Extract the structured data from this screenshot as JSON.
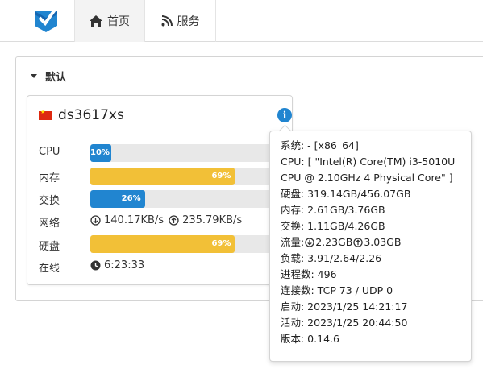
{
  "nav": {
    "home_label": "首页",
    "services_label": "服务"
  },
  "group": {
    "title": "默认"
  },
  "server": {
    "name": "ds3617xs",
    "cpu": {
      "label": "CPU",
      "percent": 10,
      "text": "10%"
    },
    "mem": {
      "label": "内存",
      "percent": 69,
      "text": "69%"
    },
    "swap": {
      "label": "交换",
      "percent": 26,
      "text": "26%"
    },
    "net": {
      "label": "网络",
      "down": "140.17KB/s",
      "up": "235.79KB/s"
    },
    "disk": {
      "label": "硬盘",
      "percent": 69,
      "text": "69%"
    },
    "uptime": {
      "label": "在线",
      "value": "6:23:33"
    }
  },
  "popup": {
    "system": "系统: - [x86_64]",
    "cpu1": "CPU: [ \"Intel(R) Core(TM) i3-5010U",
    "cpu2": "CPU @ 2.10GHz 4 Physical Core\" ]",
    "disk": "硬盘: 319.14GB/456.07GB",
    "mem": "内存: 2.61GB/3.76GB",
    "swap": "交换: 1.11GB/4.26GB",
    "traffic_label": "流量: ",
    "traffic_down": "2.23GB",
    "traffic_up": "3.03GB",
    "load": "负载: 3.91/2.64/2.26",
    "procs": "进程数: 496",
    "conns": "连接数: TCP 73 / UDP 0",
    "boot": "启动: 2023/1/25 14:21:17",
    "active": "活动: 2023/1/25 20:44:50",
    "version": "版本: 0.14.6"
  },
  "colors": {
    "blue": "#2185d0",
    "yellow": "#f2c037",
    "logo": "#2185d0"
  },
  "icons": [
    "logo-check-icon",
    "home-icon",
    "rss-icon",
    "caret-down-icon",
    "china-flag-icon",
    "info-icon",
    "arrow-down-circle-icon",
    "arrow-up-circle-icon",
    "clock-icon"
  ]
}
